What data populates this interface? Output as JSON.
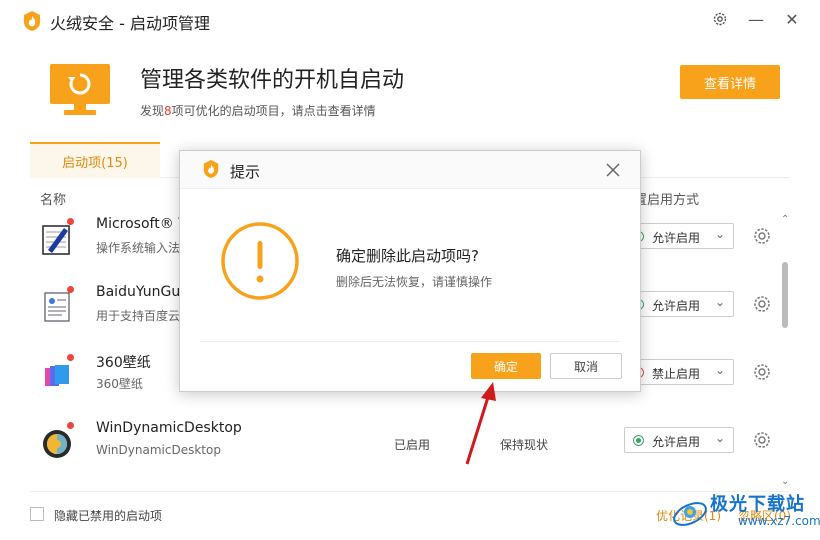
{
  "window": {
    "title": "火绒安全 - 启动项管理",
    "controls": {
      "settings": "settings-icon",
      "minimize": "—",
      "close": "✕"
    }
  },
  "hero": {
    "title": "管理各类软件的开机自启动",
    "sub_prefix": "发现",
    "sub_count": "8",
    "sub_suffix": "项可优化的启动项目，请点击查看详情",
    "detail_button": "查看详情"
  },
  "tabs": {
    "active": "启动项(15)"
  },
  "columns": {
    "name": "名称",
    "mode": "置启用方式"
  },
  "rows": [
    {
      "title": "Microsoft® V",
      "desc": "操作系统输入法",
      "status": "",
      "suggest": "",
      "mode": "允许启用",
      "mode_state": "on"
    },
    {
      "title": "BaiduYunGu",
      "desc": "用于支持百度云",
      "status": "",
      "suggest": "",
      "mode": "允许启用",
      "mode_state": "on"
    },
    {
      "title": "360壁纸",
      "desc": "360壁纸",
      "status": "",
      "suggest": "",
      "mode": "禁止启用",
      "mode_state": "off"
    },
    {
      "title": "WinDynamicDesktop",
      "desc": "WinDynamicDesktop",
      "status": "已启用",
      "suggest": "保持现状",
      "mode": "允许启用",
      "mode_state": "on"
    }
  ],
  "footer": {
    "hide_disabled": "隐藏已禁用的启动项",
    "link1": "优化记录(1)",
    "link2": "忽略区(0)"
  },
  "watermark": {
    "line1": "极光下载站",
    "line2": "www.xz7.com"
  },
  "dialog": {
    "title": "提示",
    "question": "确定删除此启动项吗?",
    "hint": "删除后无法恢复，请谨慎操作",
    "ok": "确定",
    "cancel": "取消"
  },
  "colors": {
    "accent": "#f7a21a",
    "allow": "#36a862",
    "deny": "#e14b3c",
    "annotation": "#d0191c"
  }
}
